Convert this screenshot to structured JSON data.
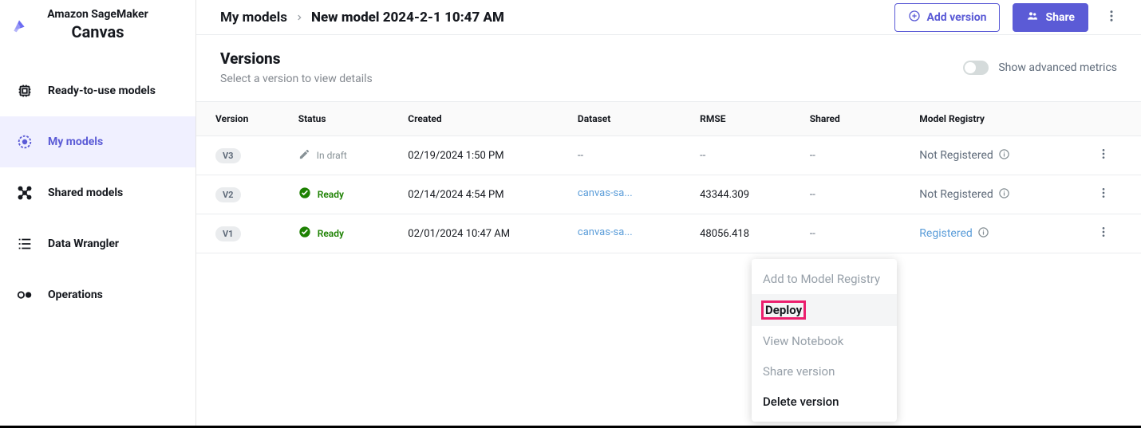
{
  "brand": {
    "top": "Amazon SageMaker",
    "bottom": "Canvas"
  },
  "nav": {
    "items": [
      {
        "label": "Ready-to-use models"
      },
      {
        "label": "My models"
      },
      {
        "label": "Shared models"
      },
      {
        "label": "Data Wrangler"
      },
      {
        "label": "Operations"
      }
    ]
  },
  "breadcrumb": {
    "root": "My models",
    "current": "New model 2024-2-1 10:47 AM"
  },
  "actions": {
    "add_version": "Add version",
    "share": "Share"
  },
  "section": {
    "title": "Versions",
    "subtitle": "Select a version to view details",
    "toggle_label": "Show advanced metrics"
  },
  "columns": {
    "version": "Version",
    "status": "Status",
    "created": "Created",
    "dataset": "Dataset",
    "rmse": "RMSE",
    "shared": "Shared",
    "registry": "Model Registry"
  },
  "rows": [
    {
      "version": "V3",
      "status_type": "draft",
      "status_text": "In draft",
      "created": "02/19/2024 1:50 PM",
      "dataset": "--",
      "rmse": "--",
      "shared": "--",
      "registry_text": "Not Registered",
      "registry_type": "none"
    },
    {
      "version": "V2",
      "status_type": "ready",
      "status_text": "Ready",
      "created": "02/14/2024 4:54 PM",
      "dataset": "canvas-sa...",
      "rmse": "43344.309",
      "shared": "--",
      "registry_text": "Not Registered",
      "registry_type": "none"
    },
    {
      "version": "V1",
      "status_type": "ready",
      "status_text": "Ready",
      "created": "02/01/2024 10:47 AM",
      "dataset": "canvas-sa...",
      "rmse": "48056.418",
      "shared": "--",
      "registry_text": "Registered",
      "registry_type": "link"
    }
  ],
  "menu": {
    "items": [
      {
        "label": "Add to Model Registry",
        "style": "muted"
      },
      {
        "label": "Deploy",
        "style": "highlight"
      },
      {
        "label": "View Notebook",
        "style": "muted"
      },
      {
        "label": "Share version",
        "style": "muted"
      },
      {
        "label": "Delete version",
        "style": "strong"
      }
    ]
  }
}
